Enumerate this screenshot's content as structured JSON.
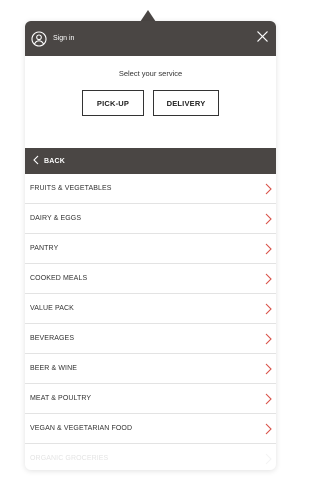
{
  "header": {
    "signin_label": "Sign in"
  },
  "service": {
    "title": "Select your service",
    "pickup_label": "PICK-UP",
    "delivery_label": "DELIVERY"
  },
  "nav": {
    "back_label": "BACK"
  },
  "categories": [
    {
      "label": "FRUITS & VEGETABLES"
    },
    {
      "label": "DAIRY & EGGS"
    },
    {
      "label": "PANTRY"
    },
    {
      "label": "COOKED MEALS"
    },
    {
      "label": "VALUE PACK"
    },
    {
      "label": "BEVERAGES"
    },
    {
      "label": "BEER & WINE"
    },
    {
      "label": "MEAT & POULTRY"
    },
    {
      "label": "VEGAN & VEGETARIAN FOOD"
    },
    {
      "label": "ORGANIC GROCERIES"
    }
  ],
  "colors": {
    "header_bg": "#4a4644",
    "chevron_accent": "#d9534a",
    "divider": "#e3e3e3"
  },
  "icons": {
    "signin": "user-circle-icon",
    "close": "close-icon",
    "back": "chevron-left-icon",
    "item": "chevron-right-icon"
  }
}
